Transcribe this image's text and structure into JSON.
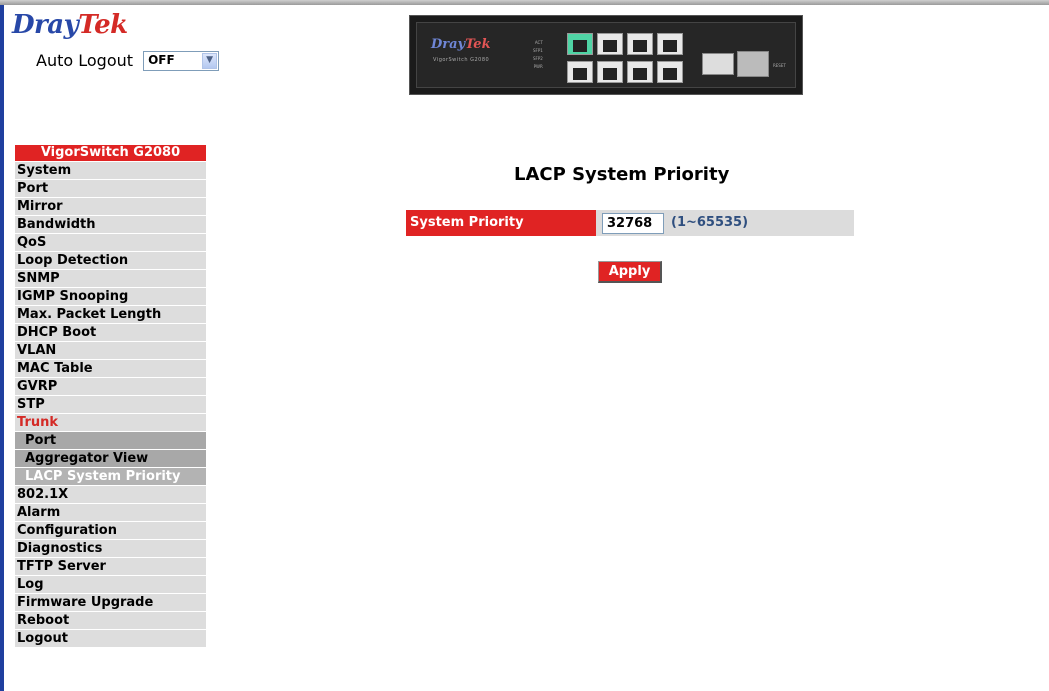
{
  "brand": {
    "part1": "Dray",
    "part2": "Tek"
  },
  "auto_logout": {
    "label": "Auto Logout",
    "value": "OFF"
  },
  "device": {
    "brand_part1": "Dray",
    "brand_part2": "Tek",
    "model": "VigorSwitch G2080",
    "led_labels": [
      "ACT",
      "SFP1",
      "SFP2",
      "PWR"
    ],
    "reset_label": "RESET"
  },
  "sidebar": {
    "header": "VigorSwitch G2080",
    "items_before": [
      "System",
      "Port",
      "Mirror",
      "Bandwidth",
      "QoS",
      "Loop Detection",
      "SNMP",
      "IGMP Snooping",
      "Max. Packet Length",
      "DHCP Boot",
      "VLAN",
      "MAC Table",
      "GVRP",
      "STP"
    ],
    "active": "Trunk",
    "subitems": [
      "Port",
      "Aggregator View",
      "LACP System Priority"
    ],
    "selected_sub": "LACP System Priority",
    "items_after": [
      "802.1X",
      "Alarm",
      "Configuration",
      "Diagnostics",
      "TFTP Server",
      "Log",
      "Firmware Upgrade",
      "Reboot",
      "Logout"
    ]
  },
  "main": {
    "title": "LACP System Priority",
    "field_label": "System Priority",
    "field_value": "32768",
    "range": "(1~65535)",
    "apply_label": "Apply"
  },
  "colors": {
    "accent_red": "#e02323",
    "brand_blue": "#2848a8",
    "menu_gray": "#dddddd"
  }
}
